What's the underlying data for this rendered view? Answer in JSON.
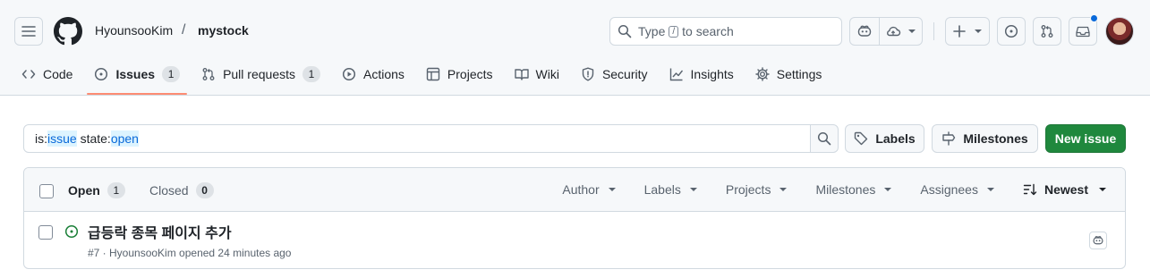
{
  "header": {
    "owner": "HyounsooKim",
    "separator": "/",
    "repo": "mystock",
    "search": {
      "prefix": "Type",
      "key": "/",
      "suffix": "to search"
    }
  },
  "repo_nav": {
    "tabs": [
      {
        "label": "Code",
        "icon": "code-icon",
        "selected": false
      },
      {
        "label": "Issues",
        "icon": "issue-opened-icon",
        "count": "1",
        "selected": true
      },
      {
        "label": "Pull requests",
        "icon": "git-pull-request-icon",
        "count": "1",
        "selected": false
      },
      {
        "label": "Actions",
        "icon": "play-icon",
        "selected": false
      },
      {
        "label": "Projects",
        "icon": "table-icon",
        "selected": false
      },
      {
        "label": "Wiki",
        "icon": "book-icon",
        "selected": false
      },
      {
        "label": "Security",
        "icon": "shield-icon",
        "selected": false
      },
      {
        "label": "Insights",
        "icon": "graph-icon",
        "selected": false
      },
      {
        "label": "Settings",
        "icon": "gear-icon",
        "selected": false
      }
    ]
  },
  "filter": {
    "tokens": [
      {
        "key": "is:",
        "value": "issue"
      },
      {
        "key": " state:",
        "value": "open"
      }
    ],
    "labels_button": "Labels",
    "milestones_button": "Milestones",
    "new_issue_button": "New issue"
  },
  "list": {
    "open_label": "Open",
    "open_count": "1",
    "closed_label": "Closed",
    "closed_count": "0",
    "filters": [
      "Author",
      "Labels",
      "Projects",
      "Milestones",
      "Assignees"
    ],
    "sort_label": "Newest",
    "issues": [
      {
        "title": "급등락 종목 페이지 추가",
        "meta": "#7 · HyounsooKim opened 24 minutes ago"
      }
    ]
  },
  "colors": {
    "accent_green": "#1f883d",
    "open_icon": "#1a7f37",
    "tab_underline": "#fd8c73",
    "link_blue": "#0969da",
    "notification_dot": "#0969da"
  }
}
